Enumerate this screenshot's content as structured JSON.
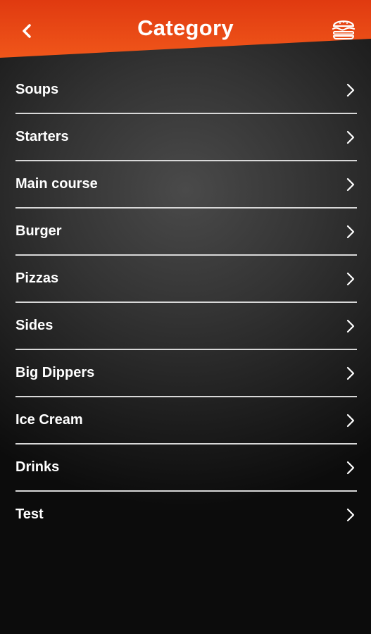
{
  "header": {
    "title": "Category",
    "back_icon": "chevron-left-icon",
    "menu_icon": "burger-icon",
    "accent_color": "#e8420f"
  },
  "categories": [
    {
      "label": "Soups"
    },
    {
      "label": "Starters"
    },
    {
      "label": "Main course"
    },
    {
      "label": "Burger"
    },
    {
      "label": "Pizzas"
    },
    {
      "label": "Sides"
    },
    {
      "label": "Big Dippers"
    },
    {
      "label": "Ice Cream"
    },
    {
      "label": "Drinks"
    },
    {
      "label": "Test"
    }
  ]
}
